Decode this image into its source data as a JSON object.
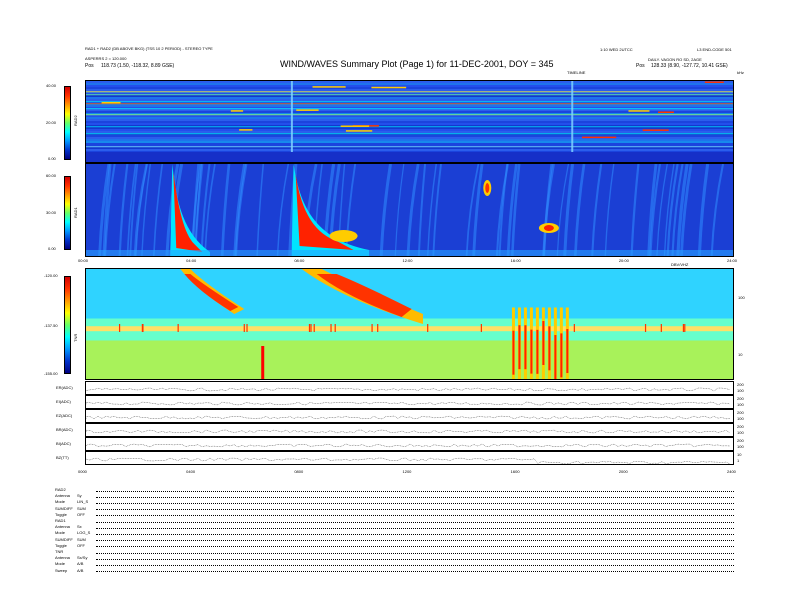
{
  "header": {
    "title": "WIND/WAVES Summary Plot (Page 1) for 11-DEC-2001, DOY = 345",
    "left_line1": "RAD1 + RAD2 (DB ABOVE BKG) (TSS 10 2 PERIOD) - STEREO TYPE",
    "left_line2": "ASPERRS 2 = 120.000",
    "left_pos_label": "Pos",
    "left_pos_value": "118.73 (1.50, -118.32, 8.89 GSE)",
    "right_line1": "1:10 WED 2UTCC",
    "right_line2": "L3 END-CODE 501",
    "right_line3": "DAILY. VAGON RO SD, 2AGE",
    "right_pos_label": "Pos",
    "right_pos_value": "128.33 (8.90, -127.72, 10.41 GSE)",
    "timeline_label": "TIMELINE",
    "khz_label": "kHz"
  },
  "panels": {
    "rad2": {
      "axis_label": "RAD2",
      "ticks": [
        "40.00",
        "20.00",
        "0.00"
      ]
    },
    "rad1": {
      "axis_label": "RAD1",
      "ticks": [
        "60.00",
        "30.00",
        "0.00"
      ]
    },
    "tnr": {
      "axis_label": "TNR",
      "ticks": [
        "-120.00",
        "-137.50",
        "-155.00"
      ],
      "right_ticks": [
        "100",
        "10"
      ],
      "extra_label": "DBV/VHZ"
    }
  },
  "time_axis": {
    "ticks": [
      "00:00",
      "04:00",
      "08:00",
      "12:00",
      "16:00",
      "20:00",
      "24:00"
    ]
  },
  "bottom_time_axis": {
    "ticks": [
      "0000",
      "0400",
      "0800",
      "1200",
      "1600",
      "2000",
      "2400"
    ]
  },
  "strips": [
    {
      "label": "ER(ADC)",
      "right": [
        "200",
        "100"
      ]
    },
    {
      "label": "EI(ADC)",
      "right": [
        "200",
        "100"
      ]
    },
    {
      "label": "EZ(ADC)",
      "right": [
        "200",
        "100"
      ]
    },
    {
      "label": "BR(ADC)",
      "right": [
        "200",
        "100"
      ]
    },
    {
      "label": "BI(ADC)",
      "right": [
        "200",
        "100"
      ]
    },
    {
      "label": "BZ(TT)",
      "right": [
        "10",
        "1"
      ]
    }
  ],
  "info_block": {
    "rad2_title": "RAD2",
    "rad2_lines": [
      {
        "k": "Antenna",
        "v": "Sy"
      },
      {
        "k": "Mode",
        "v": "LIN_S"
      },
      {
        "k": "SUMDIFF",
        "v": "SUM"
      },
      {
        "k": "Toggle",
        "v": "OFF"
      }
    ],
    "rad1_title": "RAD1",
    "rad1_lines": [
      {
        "k": "Antenna",
        "v": "Sx"
      },
      {
        "k": "Mode",
        "v": "LOG_S"
      },
      {
        "k": "SUMDIFF",
        "v": "SUM"
      },
      {
        "k": "Toggle",
        "v": "OFF"
      }
    ],
    "tnr_title": "TNR",
    "tnr_lines": [
      {
        "k": "Antenna",
        "v": "Sx/Sy"
      },
      {
        "k": "Mode",
        "v": "A/B"
      },
      {
        "k": "Sweep",
        "v": "A/B"
      }
    ]
  },
  "chart_data": [
    {
      "type": "heatmap",
      "name": "RAD2",
      "x": [
        "00:00",
        "24:00"
      ],
      "ylim": [
        0,
        40
      ],
      "ylabel": "RAD2",
      "features": [
        {
          "kind": "vertical-burst",
          "time_h": 7.6
        },
        {
          "kind": "vertical-burst",
          "time_h": 18.0
        }
      ]
    },
    {
      "type": "heatmap",
      "name": "RAD1",
      "x": [
        "00:00",
        "24:00"
      ],
      "ylim": [
        0,
        60
      ],
      "ylabel": "RAD1",
      "features": [
        {
          "kind": "type-III-burst",
          "start_h": 3.2,
          "end_h": 4.6
        },
        {
          "kind": "type-III-burst",
          "start_h": 7.7,
          "end_h": 10.5
        },
        {
          "kind": "burst",
          "start_h": 14.7,
          "end_h": 15.2
        },
        {
          "kind": "burst",
          "start_h": 16.8,
          "end_h": 17.6
        }
      ]
    },
    {
      "type": "heatmap",
      "name": "TNR",
      "x": [
        "00:00",
        "24:00"
      ],
      "ylim": [
        -155,
        -120
      ],
      "ylabel": "TNR",
      "features": [
        {
          "kind": "drift",
          "start_h": 3.5,
          "end_h": 5.5
        },
        {
          "kind": "drift",
          "start_h": 8.0,
          "end_h": 12.5
        },
        {
          "kind": "spike",
          "time_h": 6.5
        },
        {
          "kind": "spikes",
          "start_h": 15.8,
          "end_h": 17.8
        }
      ]
    }
  ]
}
